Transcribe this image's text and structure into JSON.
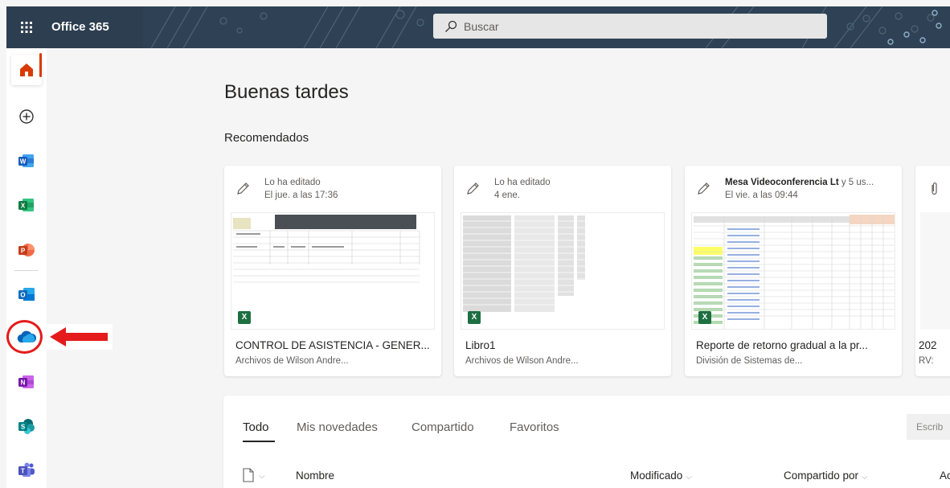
{
  "app": {
    "title": "Office 365"
  },
  "search": {
    "placeholder": "Buscar"
  },
  "nav": {
    "items": [
      {
        "name": "home-icon"
      },
      {
        "name": "create-icon"
      },
      {
        "name": "word-icon",
        "letter": "W",
        "color": "#185abd"
      },
      {
        "name": "excel-icon",
        "letter": "X",
        "color": "#107c41"
      },
      {
        "name": "powerpoint-icon",
        "letter": "P",
        "color": "#c43e1c"
      },
      {
        "name": "outlook-icon",
        "letter": "O",
        "color": "#0f6cbd"
      },
      {
        "name": "onedrive-icon",
        "color": "#0364b8"
      },
      {
        "name": "onenote-icon",
        "letter": "N",
        "color": "#7719aa"
      },
      {
        "name": "sharepoint-icon",
        "letter": "S",
        "color": "#038387"
      },
      {
        "name": "teams-icon",
        "letter": "T",
        "color": "#4b53bc"
      }
    ]
  },
  "main": {
    "greeting": "Buenas tardes",
    "recommended_title": "Recomendados",
    "cards": [
      {
        "activity_prefix": "",
        "activity": "Lo ha editado",
        "date": "El jue. a las 17:36",
        "title": "CONTROL DE ASISTENCIA - GENER...",
        "subtitle": "Archivos de Wilson Andre...",
        "app_badge": "X"
      },
      {
        "activity_prefix": "",
        "activity": "Lo ha editado",
        "date": "4 ene.",
        "title": "Libro1",
        "subtitle": "Archivos de Wilson Andre...",
        "app_badge": "X"
      },
      {
        "activity_prefix": "Mesa Videoconferencia Lt",
        "activity": " y 5 us...",
        "date": "El vie. a las 09:44",
        "title": "Reporte de retorno gradual a la pr...",
        "subtitle": "División de Sistemas de...",
        "app_badge": "X"
      },
      {
        "activity_prefix": "",
        "activity": "",
        "date": "",
        "title": "202",
        "subtitle": "RV:",
        "app_badge": ""
      }
    ],
    "tabs": [
      "Todo",
      "Mis novedades",
      "Compartido",
      "Favoritos"
    ],
    "filter_placeholder": "Escrib",
    "columns": {
      "name": "Nombre",
      "modified": "Modificado",
      "shared_by": "Compartido por",
      "activity": "Ac"
    }
  },
  "colors": {
    "topbar": "#2d3e50",
    "accent": "#d83b01",
    "annotation": "#e51b1b",
    "excel": "#1d6f42"
  }
}
